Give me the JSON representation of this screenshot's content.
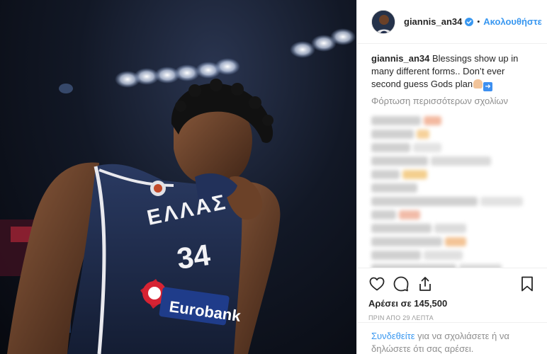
{
  "post": {
    "username": "giannis_an34",
    "follow_label": "Ακολουθήστε",
    "separator": "•",
    "caption_text": " Blessings show up in many different forms.. Don’t ever second guess Gods plan",
    "load_more": "Φόρτωση περισσότερων σχολίων",
    "likes": "Αρέσει σε 145,500",
    "time": "ΠΡΙΝ ΑΠΟ 29 ΛΕΠΤΑ",
    "login_link": "Συνδεθείτε",
    "login_text": " για να σχολιάσετε ή να δηλώσετε ότι σας αρέσει."
  },
  "photo": {
    "jersey_text": "ΕΛΛΑΣ",
    "number": "34",
    "sponsor": "Eurobank"
  },
  "icons": {
    "like": "heart-outline-icon",
    "comment": "speech-bubble-icon",
    "share": "share-upload-icon",
    "save": "bookmark-icon",
    "verified": "verified-badge-icon",
    "emojis": [
      "folded-hands-emoji",
      "right-arrow-emoji"
    ]
  },
  "colors": {
    "link": "#3897f0",
    "verified": "#3897f0",
    "muted": "#8e8e8e",
    "jersey": "#1d2a48"
  }
}
